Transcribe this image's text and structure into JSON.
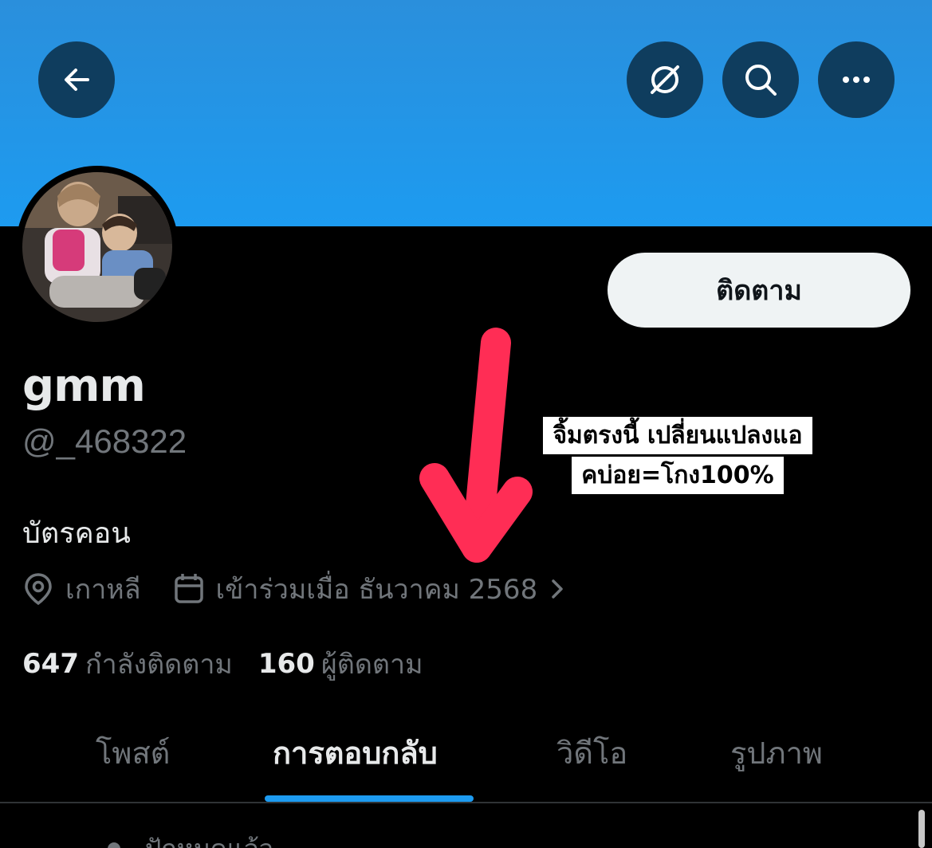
{
  "header": {
    "back_icon": "arrow-left-icon",
    "grok_icon": "grok-slash-icon",
    "search_icon": "search-icon",
    "more_icon": "more-horizontal-icon",
    "banner_color": "#1d9bf0"
  },
  "profile": {
    "follow_label": "ติดตาม",
    "name": "gmm",
    "handle": "@_468322",
    "bio": "บัตรคอน",
    "location": "เกาหลี",
    "joined": "เข้าร่วมเมื่อ ธันวาคม 2568",
    "following_count": "647",
    "following_label": "กำลังติดตาม",
    "followers_count": "160",
    "followers_label": "ผู้ติดตาม"
  },
  "tabs": [
    {
      "label": "โพสต์",
      "active": false
    },
    {
      "label": "การตอบกลับ",
      "active": true
    },
    {
      "label": "วิดีโอ",
      "active": false
    },
    {
      "label": "รูปภาพ",
      "active": false
    }
  ],
  "pinned": {
    "label": "ปักหมุดแล้ว"
  },
  "annotation": {
    "line1": "จิ้มตรงนี้ เปลี่ยนแปลงแอ",
    "line2": "คบ่อย=โกง100%",
    "arrow_color": "#ff2d55"
  }
}
